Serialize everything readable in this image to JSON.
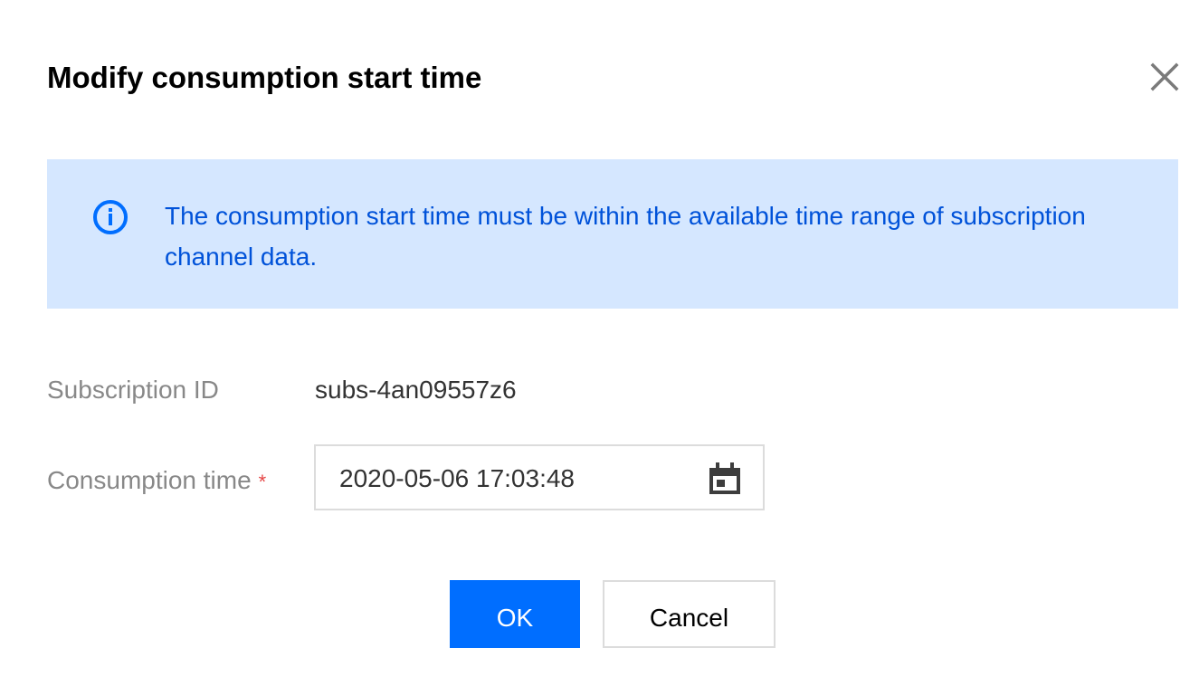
{
  "dialog": {
    "title": "Modify consumption start time",
    "close_icon": "close-icon"
  },
  "banner": {
    "icon": "info-icon",
    "text": "The consumption start time must be within the available time range of subscription channel data.",
    "background_color": "#d5e7ff",
    "text_color": "#0052d9"
  },
  "form": {
    "subscription_id": {
      "label": "Subscription ID",
      "value": "subs-4an09557z6"
    },
    "consumption_time": {
      "label": "Consumption time",
      "required_mark": "*",
      "value": "2020-05-06 17:03:48",
      "icon": "calendar-icon"
    }
  },
  "actions": {
    "ok_label": "OK",
    "cancel_label": "Cancel",
    "primary_color": "#006eff"
  }
}
